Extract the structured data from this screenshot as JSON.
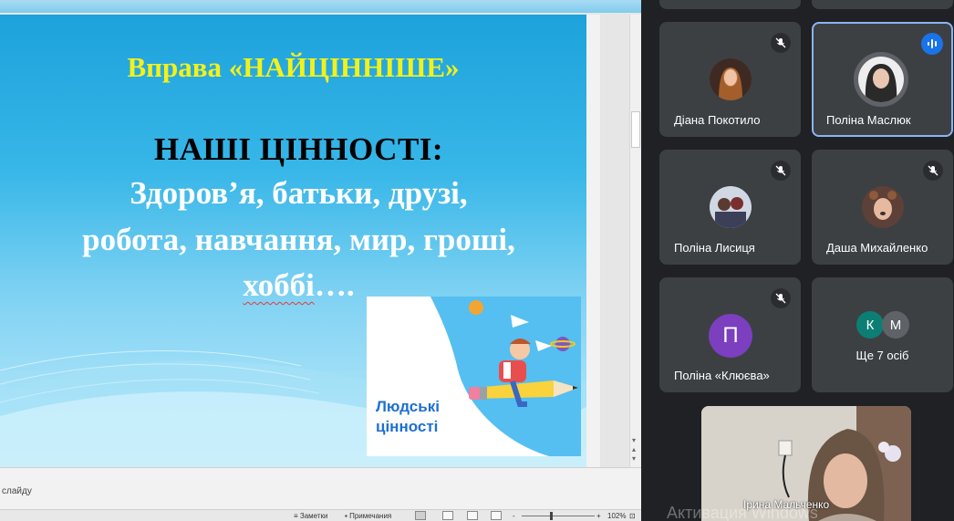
{
  "slide": {
    "title": "Вправа «НАЙЦІННІШЕ»",
    "heading": "НАШІ ЦІННОСТІ:",
    "line1": "Здоров’я, батьки, друзі,",
    "line2": "робота, навчання, мир, гроші,",
    "line3_word": "хоббі",
    "line3_tail": "….",
    "card_label_1": "Людські",
    "card_label_2": "цінності"
  },
  "ppt": {
    "notes_placeholder": "слайду",
    "status": {
      "notes": "Заметки",
      "comments": "Примечания",
      "zoom_minus": "-",
      "zoom_plus": "+",
      "zoom": "102%"
    }
  },
  "meet": {
    "participants": [
      {
        "name": "Діана Покотило",
        "muted": true
      },
      {
        "name": "Поліна Маслюк",
        "speaking": true
      },
      {
        "name": "Поліна Лисиця",
        "muted": true
      },
      {
        "name": "Даша Михайленко",
        "muted": true
      },
      {
        "name": "Поліна «Клюєва»",
        "muted": true,
        "initial": "П",
        "initial_color": "#7b3fbf"
      }
    ],
    "more": {
      "label": "Ще 7 осіб",
      "initials": [
        "К",
        "М"
      ],
      "colors": [
        "#0d7e73",
        "#5f6368"
      ]
    },
    "self": {
      "name": "Ірина Мальченко"
    },
    "watermark": "Активация Windows"
  }
}
